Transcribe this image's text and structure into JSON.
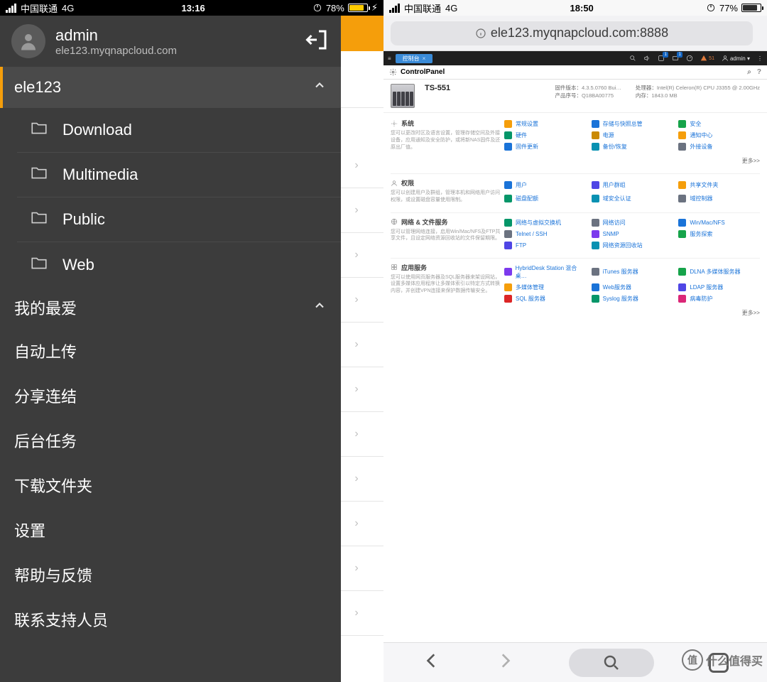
{
  "left": {
    "status": {
      "carrier": "中国联通",
      "network": "4G",
      "time": "13:16",
      "battery": "78%",
      "charging": "⚡︎"
    },
    "account": {
      "name": "admin",
      "host": "ele123.myqnapcloud.com"
    },
    "section_host": "ele123",
    "folders": [
      {
        "label": "Download"
      },
      {
        "label": "Multimedia"
      },
      {
        "label": "Public"
      },
      {
        "label": "Web"
      }
    ],
    "fav": "我的最爱",
    "menu": [
      {
        "label": "自动上传"
      },
      {
        "label": "分享连结"
      },
      {
        "label": "后台任务"
      },
      {
        "label": "下载文件夹"
      },
      {
        "label": "设置"
      },
      {
        "label": "帮助与反馈"
      },
      {
        "label": "联系支持人员"
      }
    ]
  },
  "right": {
    "status": {
      "carrier": "中国联通",
      "network": "4G",
      "time": "18:50",
      "battery": "77%"
    },
    "address": "ele123.myqnapcloud.com:8888",
    "qts_tab": "控制台",
    "qts_user": "admin ▾",
    "cp_title": "ControlPanel",
    "device": {
      "model": "TS-551",
      "fw_label": "固件版本：",
      "fw_val": "4.3.5.0760 Bui…",
      "sn_label": "产品序号：",
      "sn_val": "Q18BA00775",
      "cpu_label": "处理器：",
      "cpu_val": "Intel(R) Celeron(R) CPU J3355 @ 2.00GHz",
      "mem_label": "内存：",
      "mem_val": "1843.0 MB"
    },
    "sections": [
      {
        "title": "系统",
        "desc": "您可以更改时区及语言设置，管理存储空间及外接设备，应用通知及安全防护，或将新NAS固件及还原出厂值。",
        "items": [
          "常规设置",
          "存储与快照总管",
          "安全",
          "硬件",
          "电源",
          "通知中心",
          "固件更新",
          "备份/恢复",
          "外接设备"
        ],
        "more": "更多>>"
      },
      {
        "title": "权限",
        "desc": "您可以创建用户及群组，管理本机和网络用户访问权限，或设置磁盘容量使用限制。",
        "items": [
          "用户",
          "用户群组",
          "共享文件夹",
          "磁盘配额",
          "域安全认证",
          "域控制器"
        ]
      },
      {
        "title": "网络 & 文件服务",
        "desc": "您可以管理网络连接，启用Win/Mac/NFS及FTP共享文件，且设定网络资源回收站的文件保留期限。",
        "items": [
          "网络与虚拟交换机",
          "网络访问",
          "Win/Mac/NFS",
          "Telnet / SSH",
          "SNMP",
          "服务探索",
          "FTP",
          "网络资源回收站"
        ]
      },
      {
        "title": "应用服务",
        "desc": "您可以使用网页服务器及SQL服务器来架设网站，设置多媒体应用程序让多媒体索引以特定方式转换内容，并创建VPN连接来保护数据传输安全。",
        "items": [
          "HybridDesk Station 混合桌…",
          "iTunes 服务器",
          "DLNA 多媒体服务器",
          "多媒体管理",
          "Web服务器",
          "LDAP 服务器",
          "SQL 服务器",
          "Syslog 服务器",
          "病毒防护"
        ],
        "more": "更多>>"
      }
    ],
    "item_colors": [
      [
        "c-orange",
        "c-blue",
        "c-green",
        "c-teal",
        "c-yellow",
        "c-orange",
        "c-blue",
        "c-cyan",
        "c-gray"
      ],
      [
        "c-blue",
        "c-indigo",
        "c-orange",
        "c-teal",
        "c-cyan",
        "c-gray"
      ],
      [
        "c-teal",
        "c-gray",
        "c-blue",
        "c-gray",
        "c-purple",
        "c-green",
        "c-indigo",
        "c-cyan"
      ],
      [
        "c-purple",
        "c-gray",
        "c-green",
        "c-orange",
        "c-blue",
        "c-indigo",
        "c-red",
        "c-teal",
        "c-pink"
      ]
    ]
  },
  "watermark": "什么值得买"
}
